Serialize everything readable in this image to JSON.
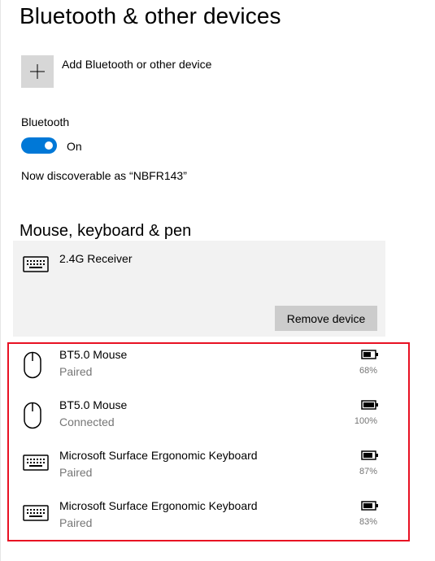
{
  "page": {
    "title": "Bluetooth & other devices"
  },
  "add_device": {
    "label": "Add Bluetooth or other device",
    "icon": "plus-icon"
  },
  "bluetooth": {
    "label": "Bluetooth",
    "state": "On",
    "toggle_on": true,
    "accent_color": "#0078d7",
    "discoverable_text": "Now discoverable as “NBFR143”"
  },
  "section": {
    "title": "Mouse, keyboard & pen"
  },
  "selected_device": {
    "name": "2.4G Receiver",
    "icon": "keyboard-icon",
    "remove_label": "Remove device"
  },
  "devices": [
    {
      "name": "BT5.0 Mouse",
      "status": "Paired",
      "battery": "68%",
      "icon": "mouse-icon"
    },
    {
      "name": "BT5.0 Mouse",
      "status": "Connected",
      "battery": "100%",
      "icon": "mouse-icon"
    },
    {
      "name": "Microsoft Surface Ergonomic Keyboard",
      "status": "Paired",
      "battery": "87%",
      "icon": "keyboard-icon"
    },
    {
      "name": "Microsoft Surface Ergonomic Keyboard",
      "status": "Paired",
      "battery": "83%",
      "icon": "keyboard-icon"
    }
  ],
  "highlight_color": "#e81123"
}
